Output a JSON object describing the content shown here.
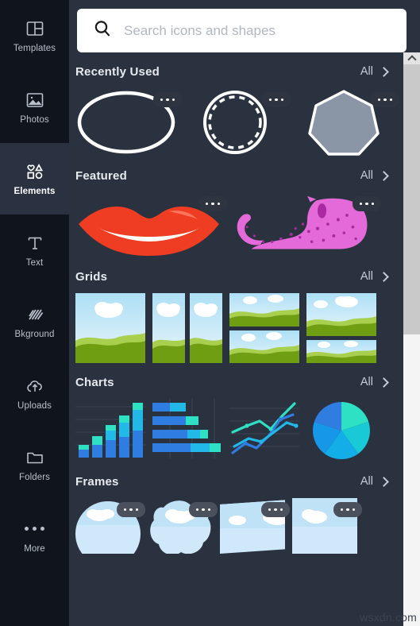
{
  "sidebar": {
    "items": [
      {
        "label": "Templates",
        "icon": "templates-icon",
        "active": false
      },
      {
        "label": "Photos",
        "icon": "photos-icon",
        "active": false
      },
      {
        "label": "Elements",
        "icon": "elements-icon",
        "active": true
      },
      {
        "label": "Text",
        "icon": "text-icon",
        "active": false
      },
      {
        "label": "Bkground",
        "icon": "background-icon",
        "active": false
      },
      {
        "label": "Uploads",
        "icon": "uploads-icon",
        "active": false
      },
      {
        "label": "Folders",
        "icon": "folders-icon",
        "active": false
      },
      {
        "label": "More",
        "icon": "more-dots-icon",
        "active": false
      }
    ]
  },
  "search": {
    "placeholder": "Search icons and shapes",
    "value": "",
    "icon": "search-icon"
  },
  "sections": [
    {
      "title": "Recently Used",
      "all_label": "All"
    },
    {
      "title": "Featured",
      "all_label": "All"
    },
    {
      "title": "Grids",
      "all_label": "All"
    },
    {
      "title": "Charts",
      "all_label": "All"
    },
    {
      "title": "Frames",
      "all_label": "All"
    }
  ],
  "recently_used": [
    {
      "name": "ellipse-outline-shape",
      "menu": "more-options"
    },
    {
      "name": "dashed-circle-shape",
      "menu": "more-options"
    },
    {
      "name": "heptagon-shape",
      "menu": "more-options"
    }
  ],
  "featured": [
    {
      "name": "red-lips-illustration",
      "menu": "more-options"
    },
    {
      "name": "pink-leopard-illustration",
      "menu": "more-options"
    }
  ],
  "grids": [
    {
      "name": "grid-single-cell"
    },
    {
      "name": "grid-two-columns"
    },
    {
      "name": "grid-two-rows"
    },
    {
      "name": "grid-two-rows-offset"
    }
  ],
  "charts": [
    {
      "name": "stacked-bar-chart"
    },
    {
      "name": "horizontal-bar-chart"
    },
    {
      "name": "line-chart"
    },
    {
      "name": "pie-chart"
    }
  ],
  "frames": [
    {
      "name": "circle-frame",
      "menu": "more-options"
    },
    {
      "name": "blob-frame",
      "menu": "more-options"
    },
    {
      "name": "rect-frame",
      "menu": "more-options"
    },
    {
      "name": "square-frame",
      "menu": "more-options"
    }
  ],
  "scrollbar": {
    "up_arrow": "chevron-up-icon"
  },
  "watermark": "wsxdn.com",
  "colors": {
    "sidebar_bg": "#10141c",
    "panel_bg": "#2b323f",
    "active_bg": "#2a3242",
    "text_muted": "#b9c0cc",
    "lips_red": "#ee3d23",
    "leopard_pink": "#e36ad8",
    "chart_blue": "#2f7de1",
    "chart_cyan": "#2ee0c4",
    "sky_blue": "#bfe2f7",
    "hill_green": "#6f9e12"
  }
}
